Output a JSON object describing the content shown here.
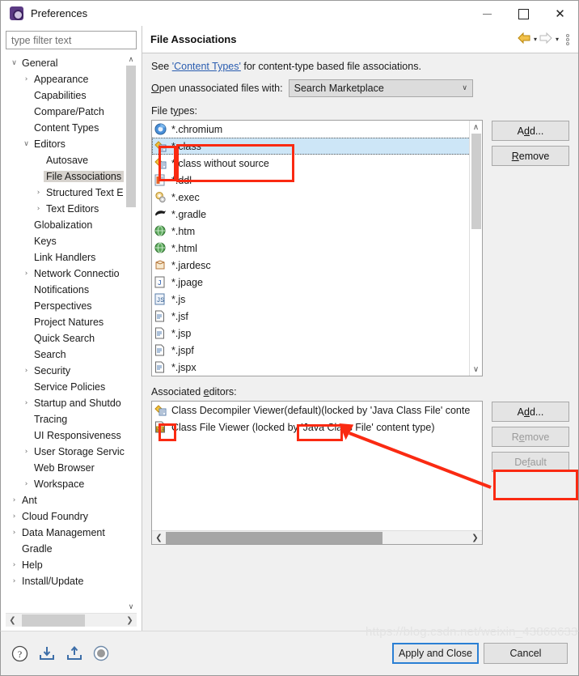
{
  "window": {
    "title": "Preferences",
    "app_icon": "preferences-icon",
    "controls": {
      "minimize": "–",
      "maximize": "□",
      "close": "✕"
    }
  },
  "sidebar": {
    "filter_placeholder": "type filter text",
    "filter_value": "",
    "scroll_up": "∧",
    "scroll_down": "∨",
    "scroll_left": "❮",
    "scroll_right": "❯",
    "items": [
      {
        "label": "General",
        "indent": 0,
        "twist": "∨"
      },
      {
        "label": "Appearance",
        "indent": 1,
        "twist": "›"
      },
      {
        "label": "Capabilities",
        "indent": 1,
        "twist": ""
      },
      {
        "label": "Compare/Patch",
        "indent": 1,
        "twist": ""
      },
      {
        "label": "Content Types",
        "indent": 1,
        "twist": ""
      },
      {
        "label": "Editors",
        "indent": 1,
        "twist": "∨"
      },
      {
        "label": "Autosave",
        "indent": 2,
        "twist": ""
      },
      {
        "label": "File Associations",
        "indent": 2,
        "twist": "",
        "selected": true
      },
      {
        "label": "Structured Text E",
        "indent": 2,
        "twist": "›"
      },
      {
        "label": "Text Editors",
        "indent": 2,
        "twist": "›"
      },
      {
        "label": "Globalization",
        "indent": 1,
        "twist": ""
      },
      {
        "label": "Keys",
        "indent": 1,
        "twist": ""
      },
      {
        "label": "Link Handlers",
        "indent": 1,
        "twist": ""
      },
      {
        "label": "Network Connectio",
        "indent": 1,
        "twist": "›"
      },
      {
        "label": "Notifications",
        "indent": 1,
        "twist": ""
      },
      {
        "label": "Perspectives",
        "indent": 1,
        "twist": ""
      },
      {
        "label": "Project Natures",
        "indent": 1,
        "twist": ""
      },
      {
        "label": "Quick Search",
        "indent": 1,
        "twist": ""
      },
      {
        "label": "Search",
        "indent": 1,
        "twist": ""
      },
      {
        "label": "Security",
        "indent": 1,
        "twist": "›"
      },
      {
        "label": "Service Policies",
        "indent": 1,
        "twist": ""
      },
      {
        "label": "Startup and Shutdo",
        "indent": 1,
        "twist": "›"
      },
      {
        "label": "Tracing",
        "indent": 1,
        "twist": ""
      },
      {
        "label": "UI Responsiveness",
        "indent": 1,
        "twist": ""
      },
      {
        "label": "User Storage Servic",
        "indent": 1,
        "twist": "›"
      },
      {
        "label": "Web Browser",
        "indent": 1,
        "twist": ""
      },
      {
        "label": "Workspace",
        "indent": 1,
        "twist": "›"
      },
      {
        "label": "Ant",
        "indent": 0,
        "twist": "›"
      },
      {
        "label": "Cloud Foundry",
        "indent": 0,
        "twist": "›"
      },
      {
        "label": "Data Management",
        "indent": 0,
        "twist": "›"
      },
      {
        "label": "Gradle",
        "indent": 0,
        "twist": ""
      },
      {
        "label": "Help",
        "indent": 0,
        "twist": "›"
      },
      {
        "label": "Install/Update",
        "indent": 0,
        "twist": "›"
      }
    ]
  },
  "page": {
    "title": "File Associations",
    "nav": {
      "back_icon": "back-arrow-icon",
      "back_caret": "▾",
      "forward_icon": "forward-arrow-icon",
      "forward_caret": "▾",
      "menu_icon": "view-menu-icon"
    },
    "see_prefix": "See ",
    "see_link": "'Content Types'",
    "see_suffix": " for content-type based file associations.",
    "open_with_label_u": "O",
    "open_with_label_rest": "pen unassociated files with:",
    "open_with_value": "Search Marketplace",
    "open_with_caret": "∨",
    "file_types_label_pre": "File t",
    "file_types_label_u": "y",
    "file_types_label_post": "pes:",
    "associated_label_pre": "Associated ",
    "associated_label_u": "e",
    "associated_label_post": "ditors:",
    "file_types": [
      {
        "label": "*.chromium",
        "icon": "chromium-icon"
      },
      {
        "label": "*.class",
        "icon": "java-class-icon",
        "selected": true,
        "focus": true
      },
      {
        "label": "*.class without source",
        "icon": "java-class-icon"
      },
      {
        "label": "*.ddl",
        "icon": "ddl-file-icon"
      },
      {
        "label": "*.exec",
        "icon": "exec-file-icon"
      },
      {
        "label": "*.gradle",
        "icon": "gradle-icon"
      },
      {
        "label": "*.htm",
        "icon": "globe-icon"
      },
      {
        "label": "*.html",
        "icon": "globe-icon"
      },
      {
        "label": "*.jardesc",
        "icon": "jar-icon"
      },
      {
        "label": "*.jpage",
        "icon": "jpage-icon"
      },
      {
        "label": "*.js",
        "icon": "js-file-icon"
      },
      {
        "label": "*.jsf",
        "icon": "text-file-icon"
      },
      {
        "label": "*.jsp",
        "icon": "text-file-icon"
      },
      {
        "label": "*.jspf",
        "icon": "text-file-icon"
      },
      {
        "label": "*.jspx",
        "icon": "text-file-icon"
      }
    ],
    "file_type_buttons": [
      {
        "pre": "A",
        "u": "d",
        "post": "d...",
        "label": "Add...",
        "enabled": true
      },
      {
        "pre": "",
        "u": "R",
        "post": "emove",
        "label": "Remove",
        "enabled": true
      }
    ],
    "associated_editors": [
      {
        "icon": "java-class-icon",
        "name": "Class Decompiler Viewer ",
        "default_tag": "(default)",
        "suffix": " (locked by 'Java Class File' conte"
      },
      {
        "icon": "class-file-viewer-icon",
        "name": "Class File Viewer (locked by 'Java Class File' content type)",
        "default_tag": "",
        "suffix": ""
      }
    ],
    "editor_buttons": [
      {
        "pre": "A",
        "u": "d",
        "post": "d...",
        "label": "Add...",
        "enabled": true
      },
      {
        "pre": "R",
        "u": "e",
        "post": "move",
        "label": "Remove",
        "enabled": false
      },
      {
        "pre": "De",
        "u": "f",
        "post": "ault",
        "label": "Default",
        "enabled": false
      }
    ],
    "scroll_up": "∧",
    "scroll_down": "∨",
    "scroll_left": "❮",
    "scroll_right": "❯"
  },
  "footer": {
    "icons": [
      {
        "name": "help-icon",
        "glyph": "?"
      },
      {
        "name": "import-icon",
        "glyph": "↙"
      },
      {
        "name": "export-icon",
        "glyph": "↗"
      },
      {
        "name": "restore-defaults-icon",
        "glyph": "●"
      }
    ],
    "apply_and_close": "Apply and Close",
    "cancel": "Cancel"
  },
  "annotation": {
    "watermark": "https://blog.csdn.net/weixin_43860633",
    "color": "#fa2a12"
  }
}
